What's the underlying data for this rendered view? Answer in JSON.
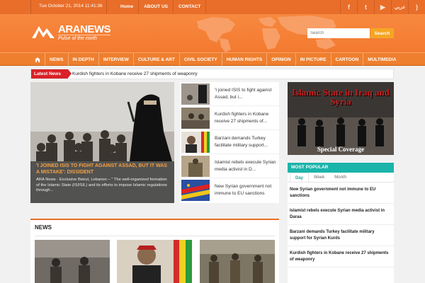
{
  "topbar": {
    "date": "Tue October 21, 2014 11:41:36",
    "links": [
      "Home",
      "ABOUT US",
      "CONTACT"
    ],
    "social": [
      {
        "icon": "facebook-icon",
        "glyph": "f"
      },
      {
        "icon": "twitter-icon",
        "glyph": "t"
      },
      {
        "icon": "youtube-icon",
        "glyph": "▶"
      },
      {
        "icon": "arabic-language-link",
        "glyph": "عربي"
      },
      {
        "icon": "rss-icon",
        "glyph": ")"
      }
    ]
  },
  "header": {
    "logo_title": "ARANEWS",
    "logo_subtitle": "Pulse of the north",
    "search_placeholder": "Search",
    "search_button": "Search"
  },
  "nav": {
    "home_icon": "home-icon",
    "items": [
      "NEWS",
      "IN DEPTH",
      "INTERVIEW",
      "CULTURE & ART",
      "CIVIL SOCIETY",
      "HUMAN RIGHTS",
      "OPINION",
      "IN PICTURE",
      "CARTOON",
      "MULTIMEDIA"
    ]
  },
  "ticker": {
    "label": "Latest News",
    "text": "Kurdish fighters in Kobane receive 27 shipments of weaponry"
  },
  "featured": {
    "title": "'I JOINED ISIS TO FIGHT AGAINST ASSAD, BUT IT WAS A MISTAKE': DISSIDENT",
    "excerpt": "ARA News - Exclusive Beirut, Lebanon – \" The well-organized formation of the Islamic State (IS/ISIL) and its efforts to impose Islamic regulations through..."
  },
  "side_list": [
    "'I joined ISIS to fight against Assad, but i...",
    "Kurdish fighters in Kobane receive 27 shipments of...",
    "Barzani demands Turkey facilitate military support...",
    "Islamist rebels execute Syrian media activist in D...",
    "New Syrian government not immune to EU sanctions"
  ],
  "news_section": {
    "heading": "NEWS"
  },
  "ad": {
    "title": "Islamic State in Iraq and Syria",
    "subtitle": "Special Coverage"
  },
  "popular": {
    "heading": "MOST POPULAR",
    "tabs": [
      "Day",
      "Week",
      "Month"
    ],
    "active_tab": "Day",
    "items": [
      "New Syrian government not immune to EU sanctions",
      "Islamist rebels execute Syrian media activist in Daraa",
      "Barzani demands Turkey facilitate military support for Syrian Kurds",
      "Kurdish fighters in Kobane receive 27 shipments of weaponry"
    ]
  },
  "colors": {
    "brand_orange": "#e96e2a",
    "accent_teal": "#1bb4aa",
    "ticker_red": "#d92128"
  }
}
